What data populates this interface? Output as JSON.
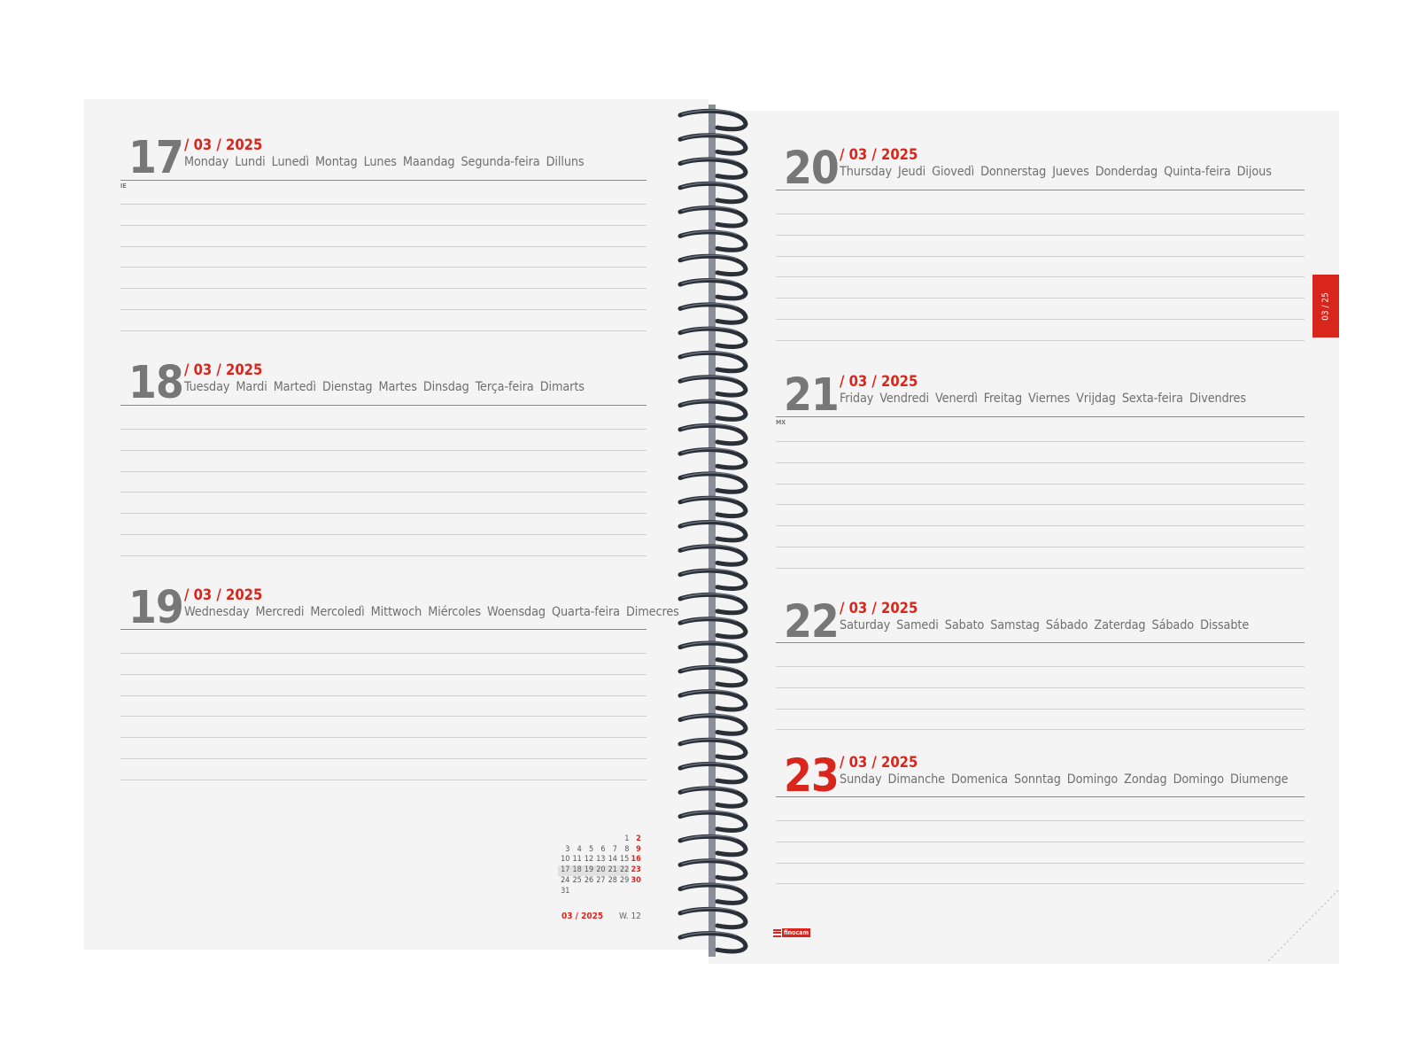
{
  "left_page": {
    "days": [
      {
        "number": "17",
        "date": "/ 03 / 2025",
        "names": [
          "Monday",
          "Lundi",
          "Lunedì",
          "Montag",
          "Lunes",
          "Maandag",
          "Segunda-feira",
          "Dilluns"
        ],
        "tag": "IE"
      },
      {
        "number": "18",
        "date": "/ 03 / 2025",
        "names": [
          "Tuesday",
          "Mardi",
          "Martedì",
          "Dienstag",
          "Martes",
          "Dinsdag",
          "Terça-feira",
          "Dimarts"
        ]
      },
      {
        "number": "19",
        "date": "/ 03 / 2025",
        "names": [
          "Wednesday",
          "Mercredi",
          "Mercoledì",
          "Mittwoch",
          "Miércoles",
          "Woensdag",
          "Quarta-feira",
          "Dimecres"
        ]
      }
    ],
    "mini_calendar": {
      "rows": [
        [
          "",
          "",
          "",
          "",
          "",
          "1",
          "2"
        ],
        [
          "3",
          "4",
          "5",
          "6",
          "7",
          "8",
          "9"
        ],
        [
          "10",
          "11",
          "12",
          "13",
          "14",
          "15",
          "16"
        ],
        [
          "17",
          "18",
          "19",
          "20",
          "21",
          "22",
          "23"
        ],
        [
          "24",
          "25",
          "26",
          "27",
          "28",
          "29",
          "30"
        ],
        [
          "31",
          "",
          "",
          "",
          "",
          "",
          ""
        ]
      ],
      "highlight_week": "17 – 23",
      "month_label": "03 / 2025",
      "week_label": "W. 12"
    }
  },
  "right_page": {
    "days": [
      {
        "number": "20",
        "date": "/ 03 / 2025",
        "names": [
          "Thursday",
          "Jeudi",
          "Giovedì",
          "Donnerstag",
          "Jueves",
          "Donderdag",
          "Quinta-feira",
          "Dijous"
        ]
      },
      {
        "number": "21",
        "date": "/ 03 / 2025",
        "names": [
          "Friday",
          "Vendredi",
          "Venerdì",
          "Freitag",
          "Viernes",
          "Vrijdag",
          "Sexta-feira",
          "Divendres"
        ],
        "tag": "MX"
      },
      {
        "number": "22",
        "date": "/ 03 / 2025",
        "names": [
          "Saturday",
          "Samedi",
          "Sabato",
          "Samstag",
          "Sábado",
          "Zaterdag",
          "Sábado",
          "Dissabte"
        ]
      },
      {
        "number": "23",
        "date": "/ 03 / 2025",
        "names": [
          "Sunday",
          "Dimanche",
          "Domenica",
          "Sonntag",
          "Domingo",
          "Zondag",
          "Domingo",
          "Diumenge"
        ]
      }
    ],
    "month_tab": "03 / 25",
    "brand": "finocam"
  },
  "colors": {
    "accent": "#d9261c",
    "page": "#f4f4f4",
    "text": "#6f6f6f",
    "spiral": "#2b2f38"
  }
}
